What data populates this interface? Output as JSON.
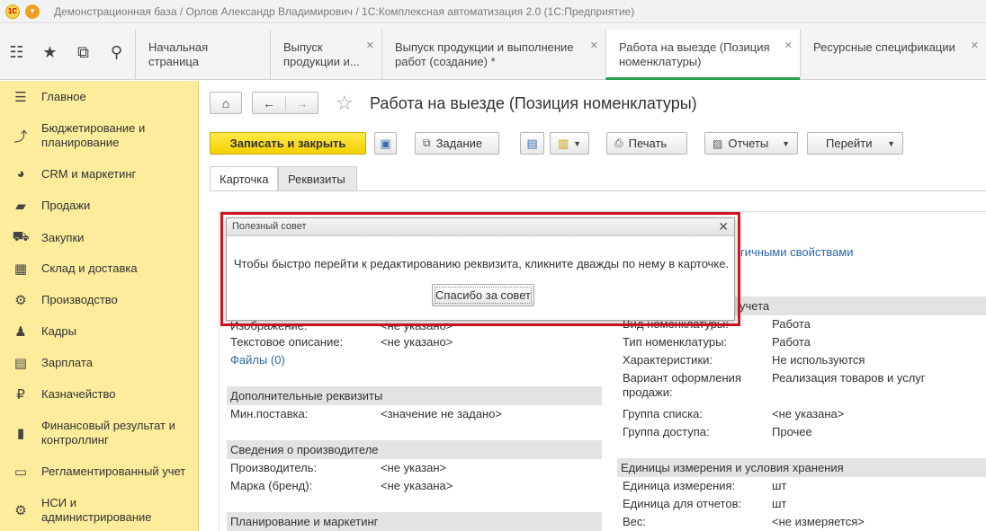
{
  "titlebar": {
    "logo_text": "1С",
    "title": "Демонстрационная база / Орлов Александр Владимирович / 1С:Комплексная автоматизация 2.0  (1С:Предприятие)"
  },
  "quick_icons": [
    "grid-icon",
    "star-icon",
    "history-icon",
    "search-icon"
  ],
  "tabs": [
    {
      "label": "Начальная страница",
      "closable": false
    },
    {
      "label": "Выпуск продукции и...",
      "closable": true
    },
    {
      "label": "Выпуск продукции и выполнение работ (создание) *",
      "closable": true
    },
    {
      "label": "Работа на выезде (Позиция номенклатуры)",
      "closable": true,
      "active": true
    },
    {
      "label": "Ресурсные спецификации",
      "closable": true
    }
  ],
  "sidebar": {
    "items": [
      {
        "label": "Главное",
        "icon": "menu-icon"
      },
      {
        "label": "Бюджетирование и планирование",
        "icon": "budget-icon"
      },
      {
        "label": "CRM и маркетинг",
        "icon": "pie-icon"
      },
      {
        "label": "Продажи",
        "icon": "sales-icon"
      },
      {
        "label": "Закупки",
        "icon": "cart-icon"
      },
      {
        "label": "Склад и доставка",
        "icon": "warehouse-icon"
      },
      {
        "label": "Производство",
        "icon": "factory-icon"
      },
      {
        "label": "Кадры",
        "icon": "people-icon"
      },
      {
        "label": "Зарплата",
        "icon": "salary-icon"
      },
      {
        "label": "Казначейство",
        "icon": "treasury-icon"
      },
      {
        "label": "Финансовый результат и контроллинг",
        "icon": "finance-icon"
      },
      {
        "label": "Регламентированный учет",
        "icon": "accounting-icon"
      },
      {
        "label": "НСИ и администрирование",
        "icon": "settings-icon"
      }
    ]
  },
  "page": {
    "title": "Работа на выезде (Позиция номенклатуры)"
  },
  "toolbar": {
    "save_close": "Записать и закрыть",
    "task": "Задание",
    "print": "Печать",
    "reports": "Отчеты",
    "goto": "Перейти"
  },
  "form_tabs": {
    "card": "Карточка",
    "requisites": "Реквизиты"
  },
  "form": {
    "left": {
      "image_label": "Изображение:",
      "image_value": "<не указано>",
      "text_label": "Текстовое описание:",
      "text_value": "<не указано>",
      "files_link": "Файлы (0)",
      "extra_section": "Дополнительные реквизиты",
      "minsupply_label": "Мин.поставка:",
      "minsupply_value": "<значение не задано>",
      "maker_section": "Сведения о производителе",
      "maker_label": "Производитель:",
      "maker_value": "<не указан>",
      "brand_label": "Марка (бренд):",
      "brand_value": "<не указана>",
      "planning_section": "Планирование и маркетинг"
    },
    "right": {
      "similar_link": "гичными свойствами",
      "acct_section": "учета",
      "kind_label": "Вид номенклатуры:",
      "kind_value": "Работа",
      "type_label": "Тип номенклатуры:",
      "type_value": "Работа",
      "char_label": "Характеристики:",
      "char_value": "Не используются",
      "variant_label": "Вариант оформления продажи:",
      "variant_value": "Реализация товаров и услуг",
      "group_label": "Группа списка:",
      "group_value": "<не указана>",
      "access_label": "Группа доступа:",
      "access_value": "Прочее",
      "units_section": "Единицы измерения и условия хранения",
      "unit_label": "Единица измерения:",
      "unit_value": "шт",
      "report_unit_label": "Единица для отчетов:",
      "report_unit_value": "шт",
      "weight_label": "Вес:",
      "weight_value": "<не измеряется>"
    }
  },
  "dialog": {
    "title": "Полезный совет",
    "message": "Чтобы быстро перейти к редактированию реквизита, кликните дважды по нему в карточке.",
    "button": "Спасибо за совет"
  },
  "colors": {
    "sidebar_bg": "#fcec9c",
    "primary_button": "#f5d000",
    "highlight_frame": "#d0151f",
    "active_tab_underline": "#2a9d4a",
    "link": "#2d64a8"
  }
}
